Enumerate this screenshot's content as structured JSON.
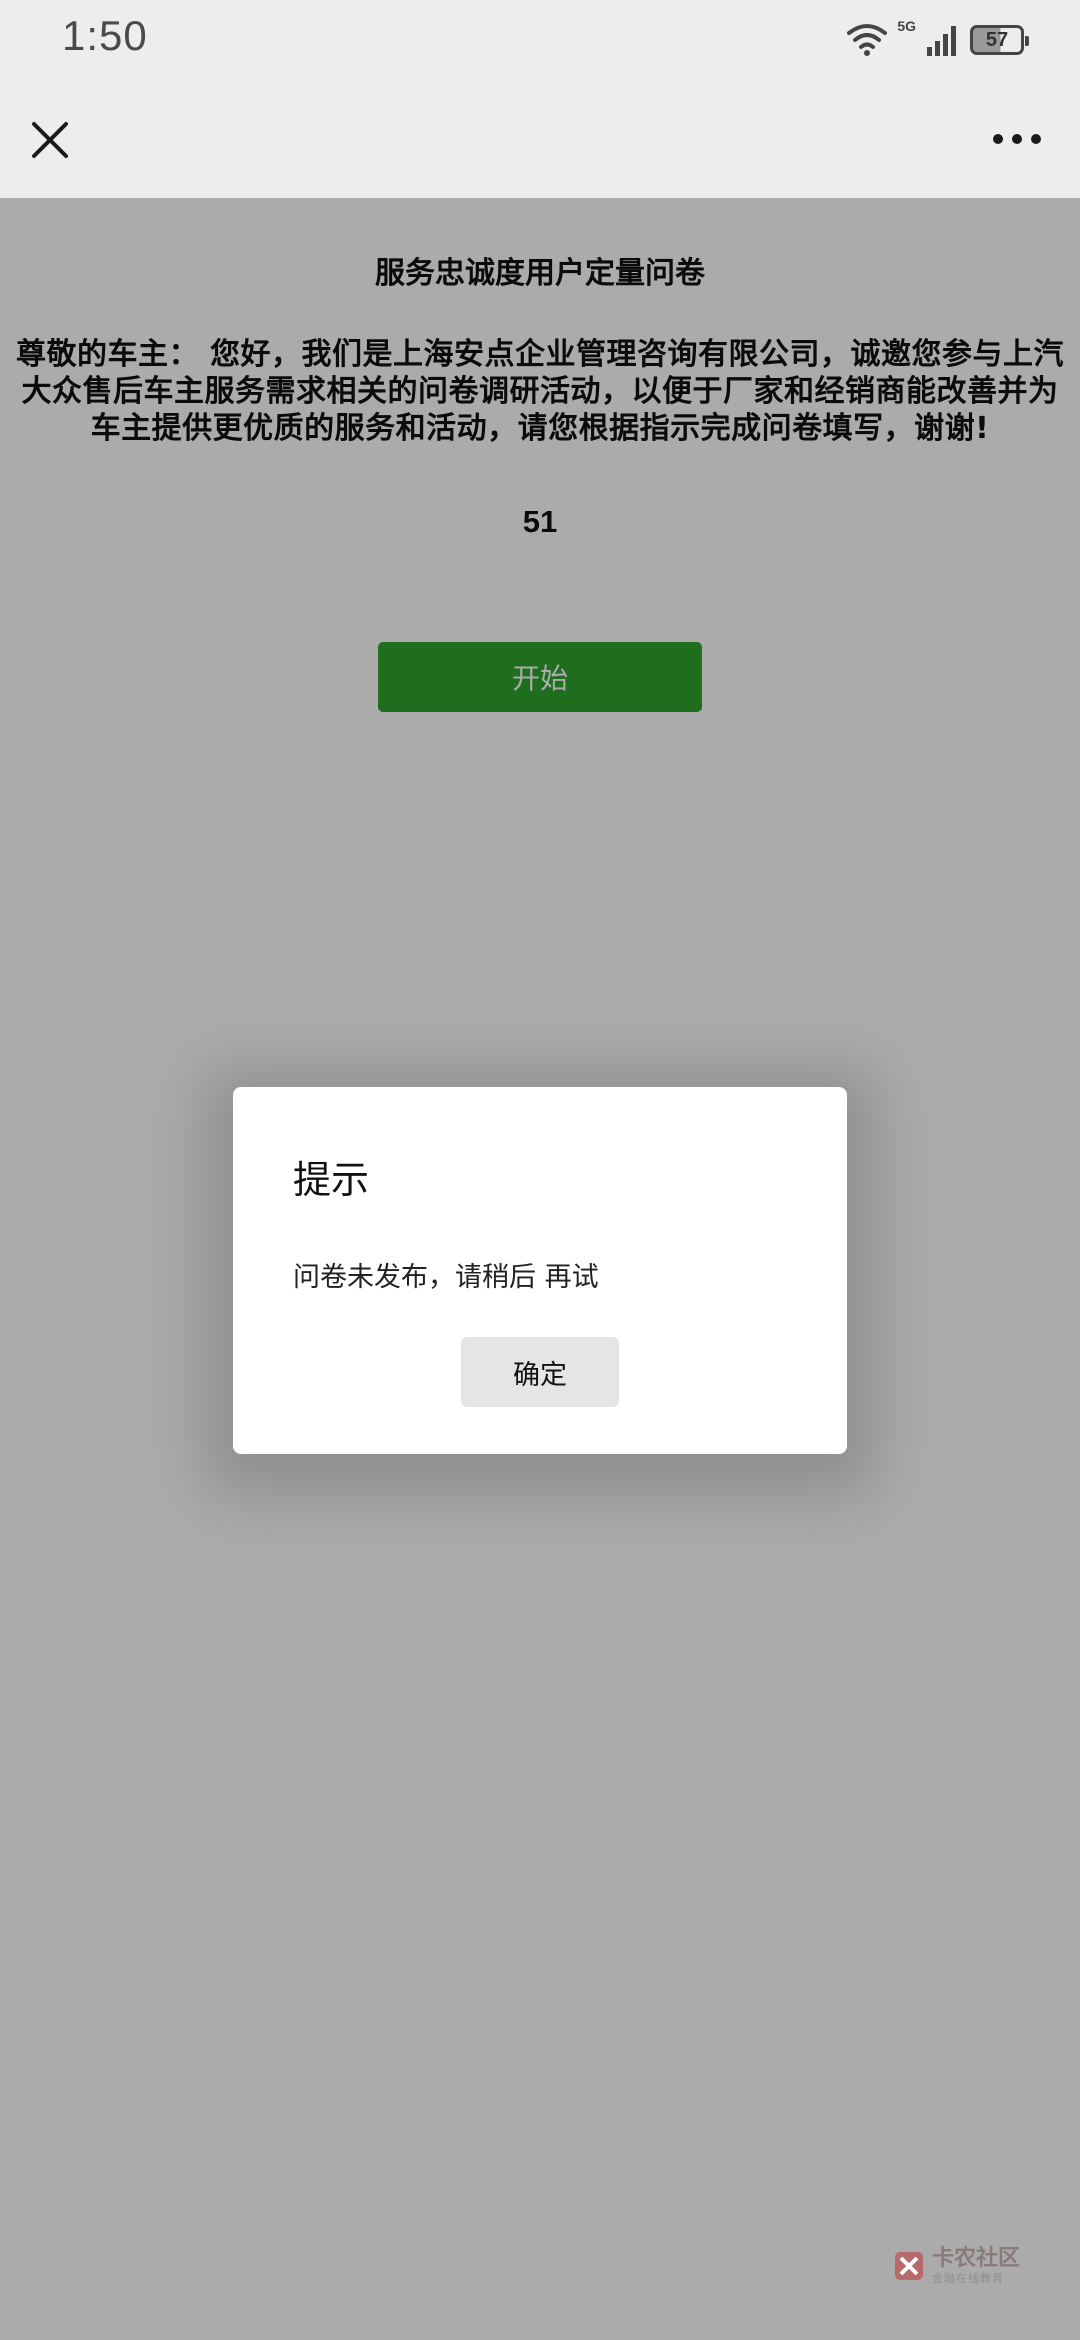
{
  "status_bar": {
    "time": "1:50",
    "network": "5G",
    "battery": "57"
  },
  "nav": {
    "close_icon": "close-icon",
    "more_icon": "more-dots-icon"
  },
  "survey": {
    "title": "服务忠诚度用户定量问卷",
    "intro_lines": [
      "尊敬的车主： 您好，我们是上海安点企业管理咨询有限公司，诚邀您参与上汽",
      "大众售后车主服务需求相关的问卷调研活动，以便于厂家和经销商能改善并为",
      "车主提供更优质的服务和活动，请您根据指示完成问卷填写，谢谢!"
    ],
    "number": "51",
    "start_label": "开始",
    "start_color": "#2ea52e"
  },
  "dialog": {
    "title": "提示",
    "message": "问卷未发布，请稍后 再试",
    "confirm_label": "确定"
  },
  "watermark": {
    "main": "卡农社区",
    "sub": "金融在线教育"
  },
  "colors": {
    "nav_bg": "#ededed",
    "overlay": "rgba(0,0,0,0.33)",
    "button_green": "#2ea52e"
  }
}
